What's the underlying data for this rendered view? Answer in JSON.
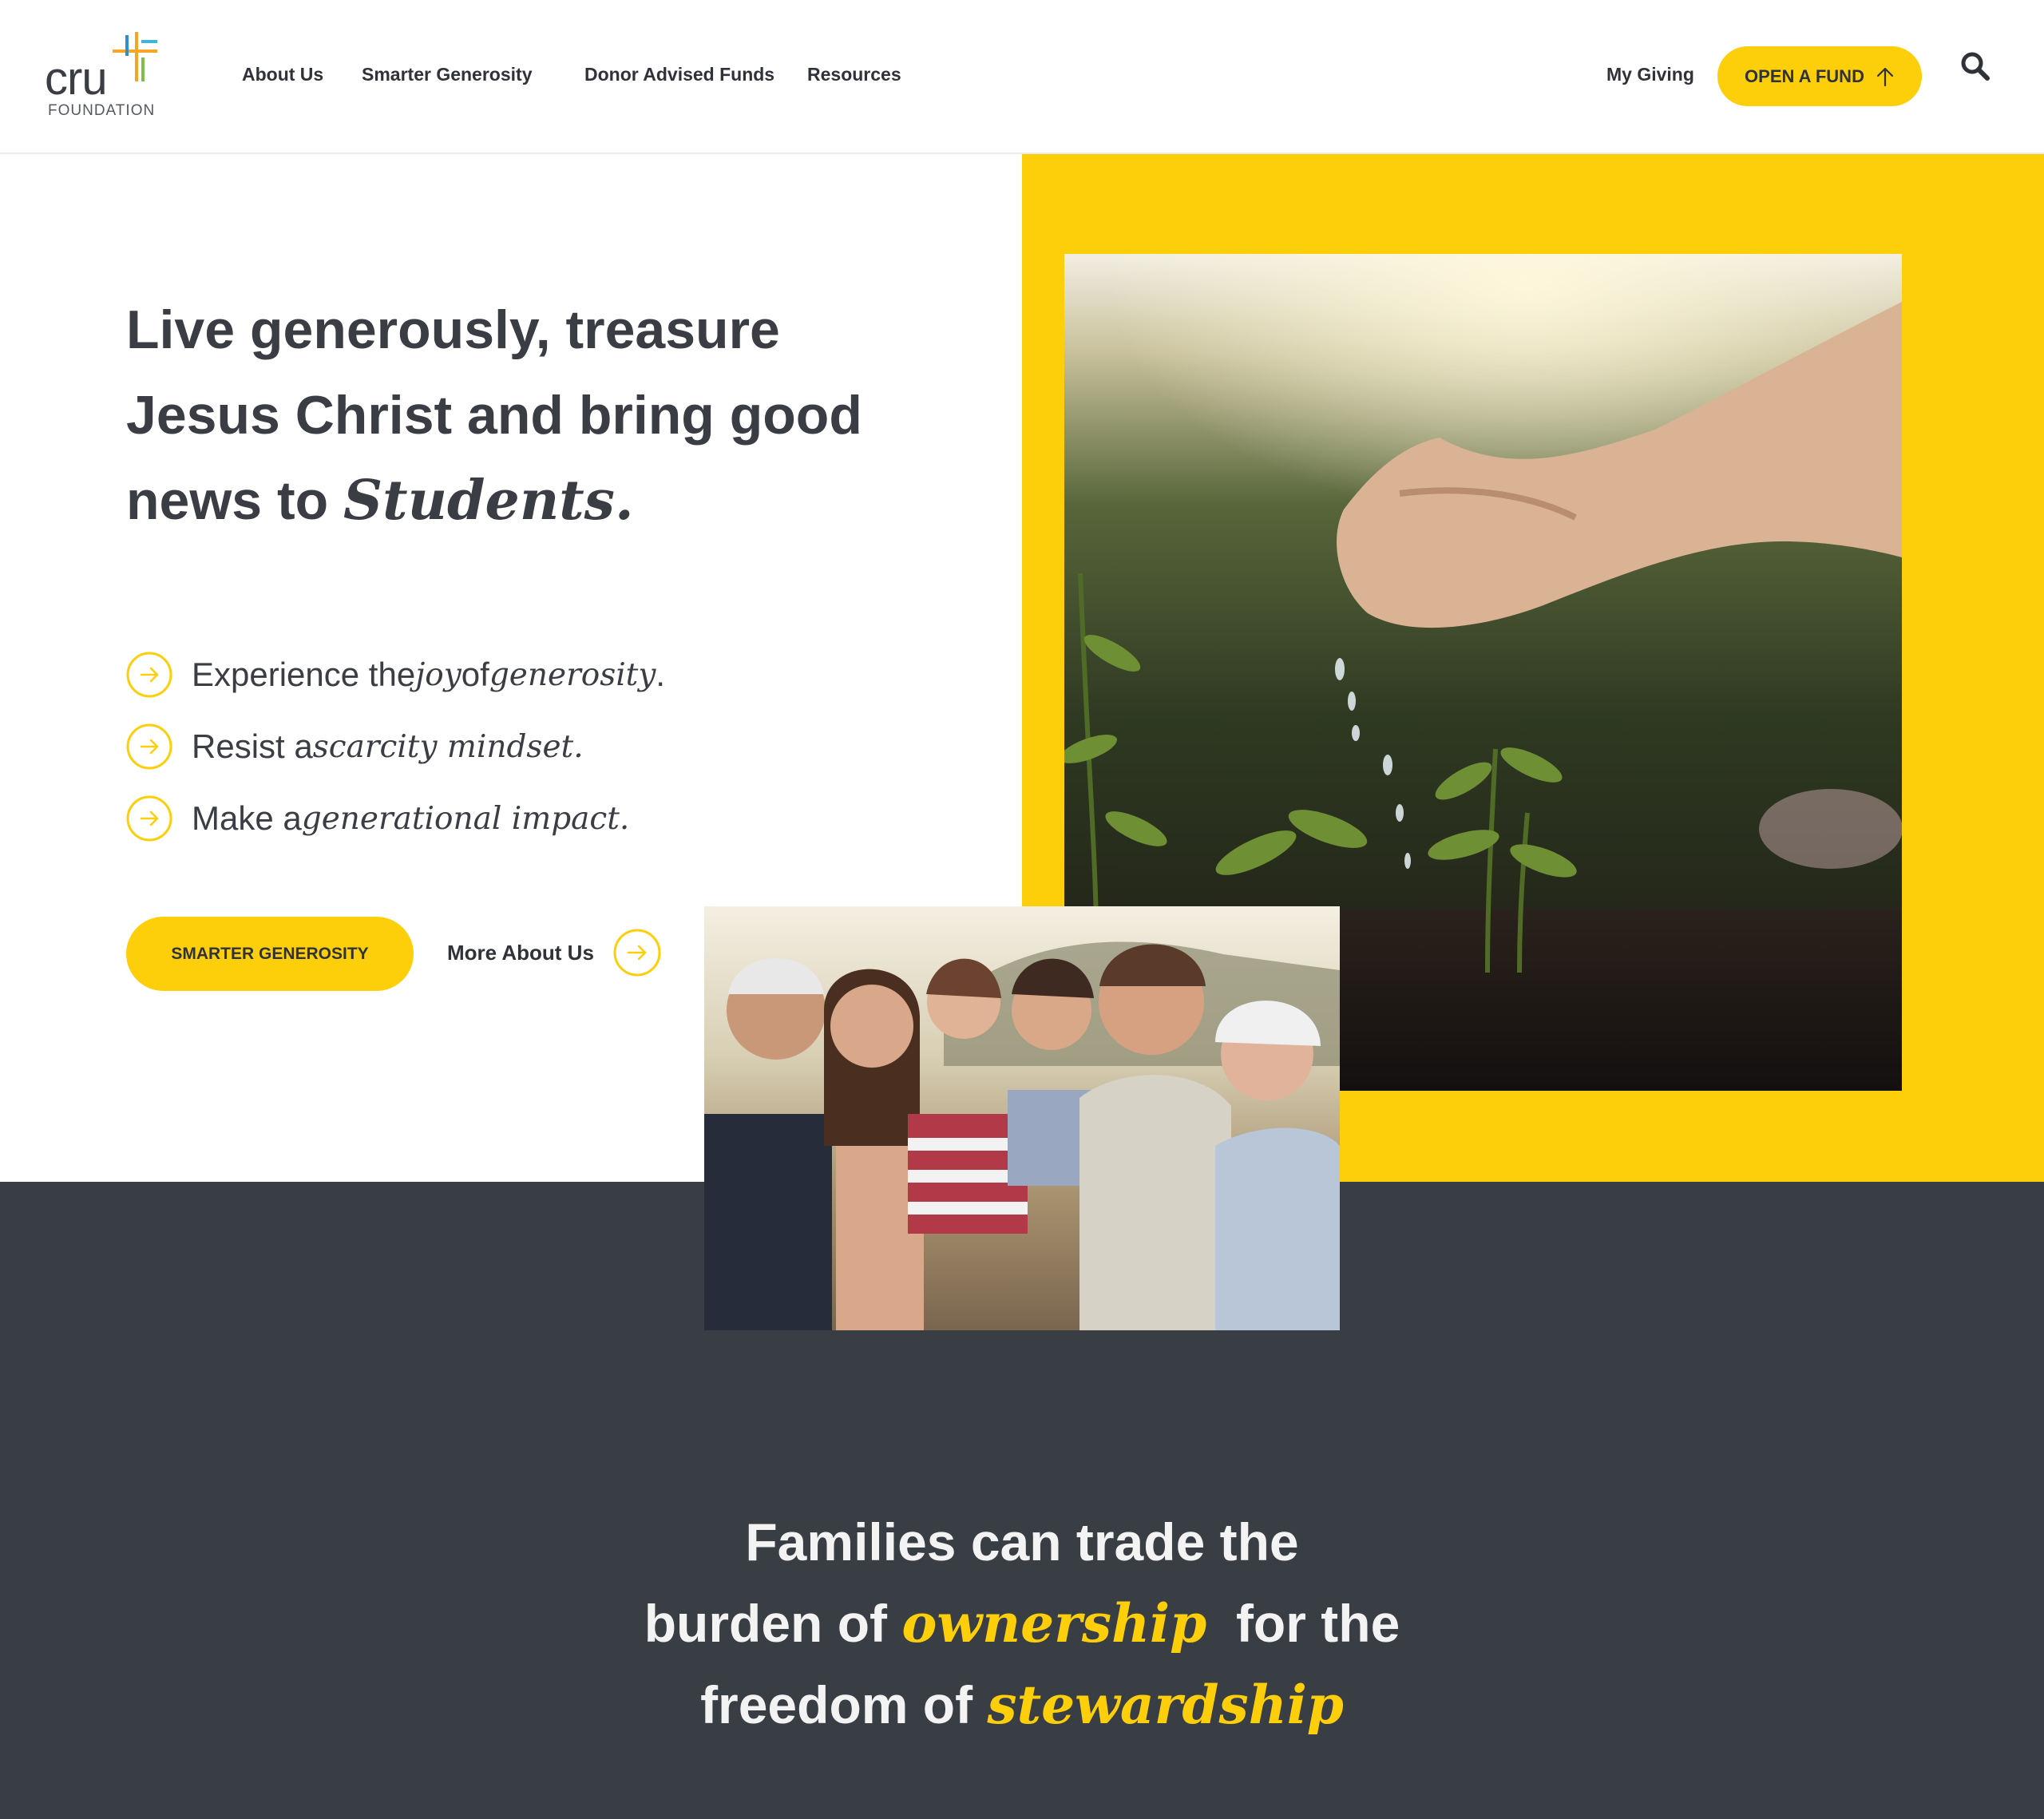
{
  "brand": {
    "logo_text": "cru",
    "logo_sub": "FOUNDATION",
    "accent_color": "#fdcf0b",
    "dark_color": "#393d44"
  },
  "nav": {
    "items": [
      "About Us",
      "Smarter Generosity",
      "Donor Advised Funds",
      "Resources"
    ],
    "my_giving": "My Giving",
    "open_fund": "OPEN A FUND",
    "search_icon": "search-icon"
  },
  "hero": {
    "heading_line1": "Live generously, treasure",
    "heading_line2": "Jesus Christ and bring good",
    "heading_line3_prefix": "news to ",
    "heading_line3_accent": "Students.",
    "bullets": [
      {
        "pre": "Experience the ",
        "it1": "joy",
        "mid": " of ",
        "it2": "generosity",
        "post": "."
      },
      {
        "pre": "Resist a ",
        "it1": "scarcity mindset.",
        "mid": "",
        "it2": "",
        "post": ""
      },
      {
        "pre": "Make a ",
        "it1": "generational impact.",
        "mid": "",
        "it2": "",
        "post": ""
      }
    ],
    "primary_button": "SMARTER GENEROSITY",
    "secondary_link": "More About Us"
  },
  "statement": {
    "line1": "Families can trade the",
    "line2_pre": "burden of ",
    "line2_accent": "ownership",
    "line2_post": "  for the",
    "line3_pre": "freedom of ",
    "line3_accent": "stewardship"
  }
}
